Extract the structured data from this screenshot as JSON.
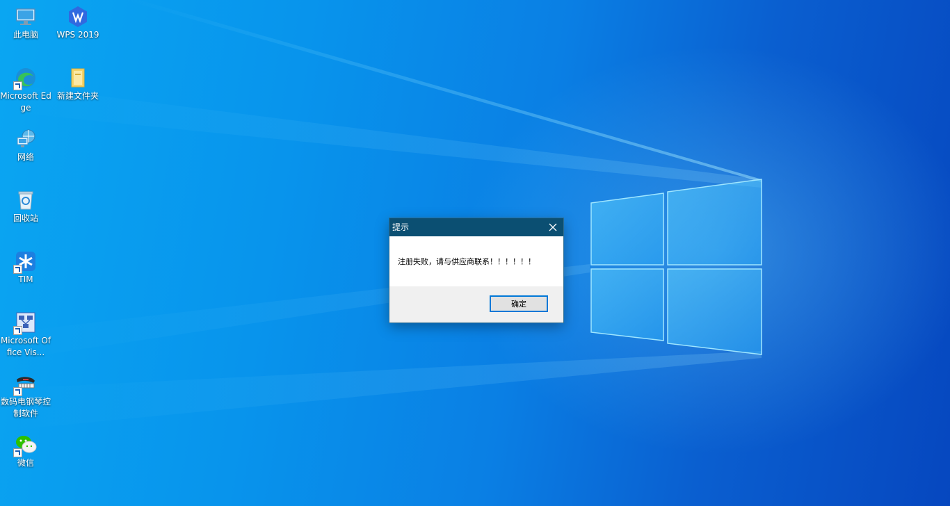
{
  "desktop": {
    "icons": [
      {
        "label": "此电脑",
        "icon": "this-pc-icon"
      },
      {
        "label": "WPS 2019",
        "icon": "wps-icon"
      },
      {
        "label": "Microsoft Edge",
        "icon": "edge-icon"
      },
      {
        "label": "新建文件夹",
        "icon": "folder-icon"
      },
      {
        "label": "网络",
        "icon": "network-icon"
      },
      {
        "label": "回收站",
        "icon": "recycle-bin-icon"
      },
      {
        "label": "TIM",
        "icon": "tim-icon"
      },
      {
        "label": "Microsoft Office Vis...",
        "icon": "visio-icon"
      },
      {
        "label": "数码电钢琴控制软件",
        "icon": "piano-software-icon"
      },
      {
        "label": "微信",
        "icon": "wechat-icon"
      }
    ]
  },
  "dialog": {
    "title": "提示",
    "message": "注册失败，请与供应商联系！！！！！！",
    "ok_label": "确定"
  },
  "colors": {
    "dialog_titlebar": "#0b4f72",
    "button_border": "#0078d7",
    "footer_bg": "#f0f0f0"
  }
}
